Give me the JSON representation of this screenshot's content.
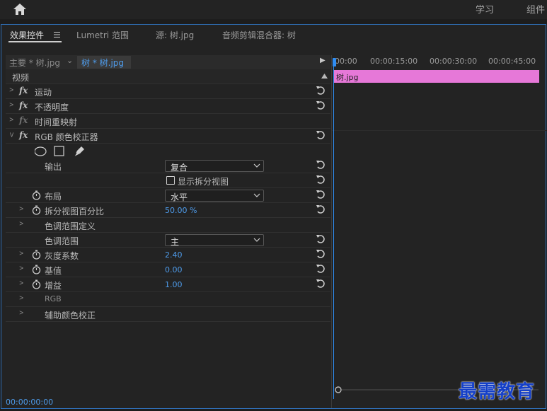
{
  "topbar": {
    "workspace_learn": "学习",
    "workspace_assembly": "组件"
  },
  "tabs": [
    {
      "label": "效果控件"
    },
    {
      "label": "Lumetri 范围"
    },
    {
      "label": "源: 树.jpg"
    },
    {
      "label": "音频剪辑混合器: 树"
    }
  ],
  "source": {
    "main": "主要 * 树.jpg",
    "clip": "树 * 树.jpg"
  },
  "rows": {
    "video": "视频",
    "motion": "运动",
    "opacity": "不透明度",
    "time_remap": "时间重映射",
    "rgb_corrector": "RGB 颜色校正器",
    "output_label": "输出",
    "output_value": "复合",
    "show_split_label": "显示拆分视图",
    "layout_label": "布局",
    "layout_value": "水平",
    "split_percent_label": "拆分视图百分比",
    "split_percent_value": "50.00 %",
    "tonal_range_def": "色调范围定义",
    "tonal_range_label": "色调范围",
    "tonal_range_value": "主",
    "gamma_label": "灰度系数",
    "gamma_value": "2.40",
    "pedestal_label": "基值",
    "pedestal_value": "0.00",
    "gain_label": "增益",
    "gain_value": "1.00",
    "rgb_label": "RGB",
    "secondary_label": "辅助颜色校正"
  },
  "fx_symbol": "fx",
  "timeline": {
    "ticks": [
      "00:00",
      "00:00:15:00",
      "00:00:30:00",
      "00:00:45:00"
    ],
    "clip_label": "树.jpg",
    "clip_color": "#e678d8"
  },
  "status": {
    "timecode": "00:00:00:00"
  },
  "watermark": "最需教育"
}
